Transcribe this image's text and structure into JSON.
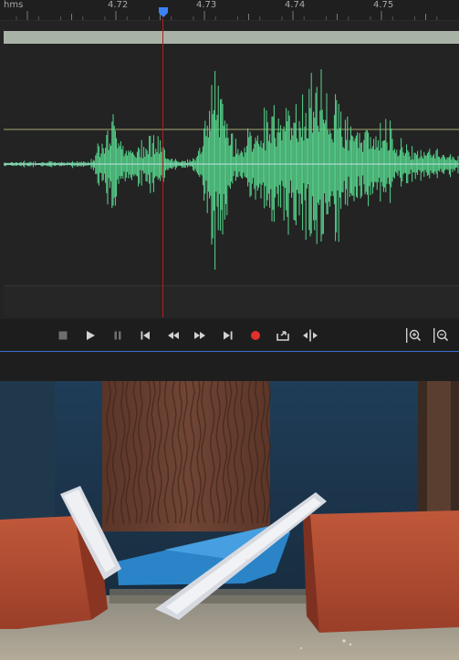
{
  "ruler": {
    "unit_label": "hms",
    "ticks": [
      "4.72",
      "4.73",
      "4.74",
      "4.75"
    ]
  },
  "waveform": {
    "color": "#58d68d",
    "background": "#232323"
  },
  "playhead": {
    "color": "#b1201f",
    "handle_color": "#3b82f6"
  },
  "transport": {
    "buttons": [
      {
        "name": "stop-button",
        "icon": "stop-icon",
        "enabled": false
      },
      {
        "name": "play-button",
        "icon": "play-icon",
        "enabled": true
      },
      {
        "name": "pause-button",
        "icon": "pause-icon",
        "enabled": false
      },
      {
        "name": "go-to-start-button",
        "icon": "skip-start-icon",
        "enabled": true
      },
      {
        "name": "rewind-button",
        "icon": "rewind-icon",
        "enabled": true
      },
      {
        "name": "fast-forward-button",
        "icon": "fast-forward-icon",
        "enabled": true
      },
      {
        "name": "go-to-end-button",
        "icon": "skip-end-icon",
        "enabled": true
      },
      {
        "name": "record-button",
        "icon": "record-icon",
        "enabled": true
      },
      {
        "name": "loop-playback-button",
        "icon": "loop-icon",
        "enabled": true
      },
      {
        "name": "skip-selection-button",
        "icon": "skip-selection-icon",
        "enabled": true
      },
      {
        "name": "zoom-in-amplitude-button",
        "icon": "zoom-in-icon",
        "enabled": true
      },
      {
        "name": "zoom-out-amplitude-button",
        "icon": "zoom-out-icon",
        "enabled": true
      }
    ],
    "record_color": "#e0312b",
    "accent_color": "#3b6ed0"
  },
  "video": {
    "description_icon": "video-frame"
  }
}
